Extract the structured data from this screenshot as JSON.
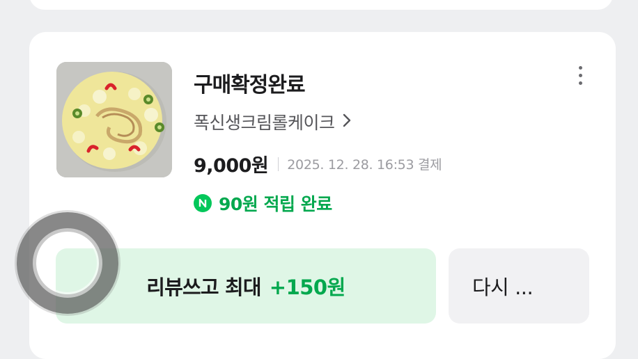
{
  "order": {
    "status": "구매확정완료",
    "product_name": "폭신생크림롤케이크",
    "product_chevron": ">",
    "price": "9,000원",
    "paid_at": "2025. 12. 28. 16:53 결제",
    "reward_icon": "npay-icon",
    "reward_text": "90원 적립 완료",
    "thumbnail": "cake-photo"
  },
  "actions": {
    "review_label": "리뷰쓰고 최대",
    "review_amount": "+150원",
    "rebuy_label": "다시 ..."
  },
  "colors": {
    "accent_green": "#03a84e",
    "npay_green": "#03c75a",
    "review_bg": "#dff6e6",
    "card_bg": "#ffffff",
    "page_bg": "#eeeff1"
  }
}
